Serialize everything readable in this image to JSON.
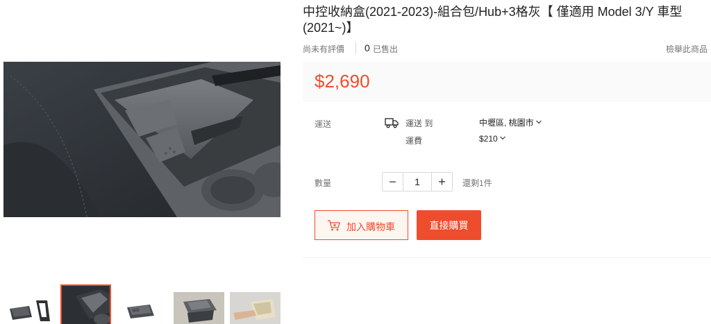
{
  "product": {
    "title": "中控收納盒(2021-2023)-組合包/Hub+3格灰【 僅適用 Model 3/Y 車型 (2021~)】",
    "no_rating": "尚未有評價",
    "sold_count": "0",
    "sold_label": "已售出",
    "report_label": "檢舉此商品",
    "price": "$2,690"
  },
  "shipping": {
    "label": "運送",
    "to_label": "運送 到",
    "location": "中壢區, 桃園市",
    "fee_label": "運費",
    "fee_value": "$210"
  },
  "quantity": {
    "label": "數量",
    "value": "1",
    "minus": "−",
    "plus": "+",
    "stock": "還剩1件"
  },
  "actions": {
    "add_to_cart": "加入購物車",
    "buy_now": "直接購買"
  },
  "gallery": {
    "selected_index": 1,
    "thumb_count": 5
  },
  "colors": {
    "accent": "#ee4d2d",
    "price_bg": "#fafafa",
    "cart_bg": "#fff5f1"
  }
}
